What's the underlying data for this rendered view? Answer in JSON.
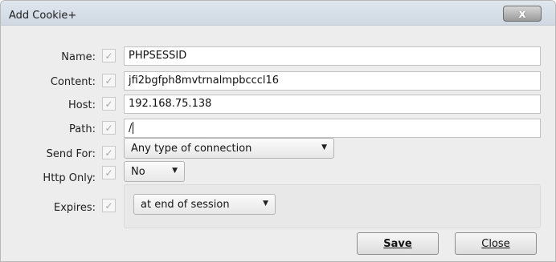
{
  "window": {
    "title": "Add Cookie+",
    "close_glyph": "x"
  },
  "form": {
    "name": {
      "label": "Name:",
      "value": "PHPSESSID",
      "checkbox_icon": "check-icon"
    },
    "content": {
      "label": "Content:",
      "value": "jfi2bgfph8mvtrnalmpbcccl16"
    },
    "host": {
      "label": "Host:",
      "value": "192.168.75.138"
    },
    "path": {
      "label": "Path:",
      "value": "/"
    },
    "send_for": {
      "label": "Send For:",
      "selected": "Any type of connection"
    },
    "http_only": {
      "label": "Http Only:",
      "selected": "No"
    },
    "expires": {
      "label": "Expires:",
      "selected": "at end of session"
    }
  },
  "buttons": {
    "save": "Save",
    "close": "Close"
  },
  "glyphs": {
    "check": "✓",
    "dropdown_arrow": "▼"
  },
  "colors": {
    "dialog_bg": "#ededed",
    "titlebar": "#d6dee7"
  }
}
